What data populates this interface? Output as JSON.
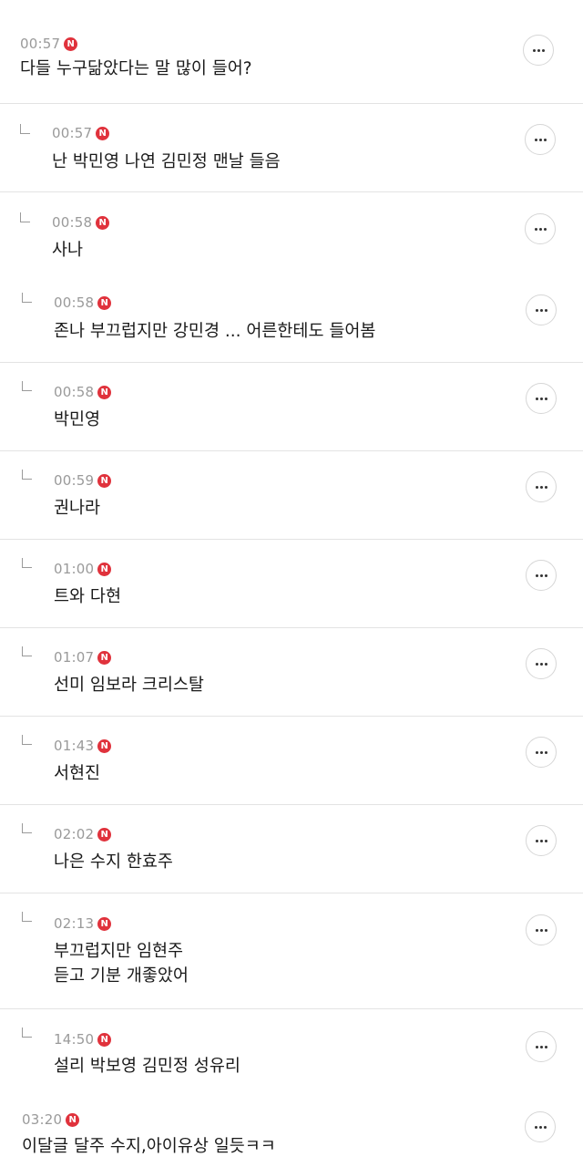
{
  "new_badge": "N",
  "colors": {
    "new_badge": "#e0323c",
    "timestamp": "#9a9a9a",
    "text": "#1a1a1a",
    "divider": "#e3e3e3"
  },
  "comments": [
    {
      "time": "00:57",
      "text": "다들 누구닮았다는 말 많이 들어?",
      "reply": false
    },
    {
      "time": "00:57",
      "text": "난 박민영 나연 김민정 맨날 들음",
      "reply": true
    },
    {
      "time": "00:58",
      "text": "사나",
      "reply": true
    },
    {
      "time": "00:58",
      "text": "존나 부끄럽지만 강민경 ... 어른한테도 들어봄",
      "reply": true
    },
    {
      "time": "00:58",
      "text": "박민영",
      "reply": true
    },
    {
      "time": "00:59",
      "text": "권나라",
      "reply": true
    },
    {
      "time": "01:00",
      "text": "트와 다현",
      "reply": true
    },
    {
      "time": "01:07",
      "text": "선미 임보라 크리스탈",
      "reply": true
    },
    {
      "time": "01:43",
      "text": "서현진",
      "reply": true
    },
    {
      "time": "02:02",
      "text": "나은 수지 한효주",
      "reply": true
    },
    {
      "time": "02:13",
      "text": "부끄럽지만 임현주\n듣고 기분 개좋았어",
      "reply": true
    },
    {
      "time": "14:50",
      "text": "설리 박보영 김민정 성유리",
      "reply": true
    },
    {
      "time": "03:20",
      "text": "이달글 달주 수지,아이유상 일듯ㅋㅋ",
      "reply": false
    }
  ]
}
